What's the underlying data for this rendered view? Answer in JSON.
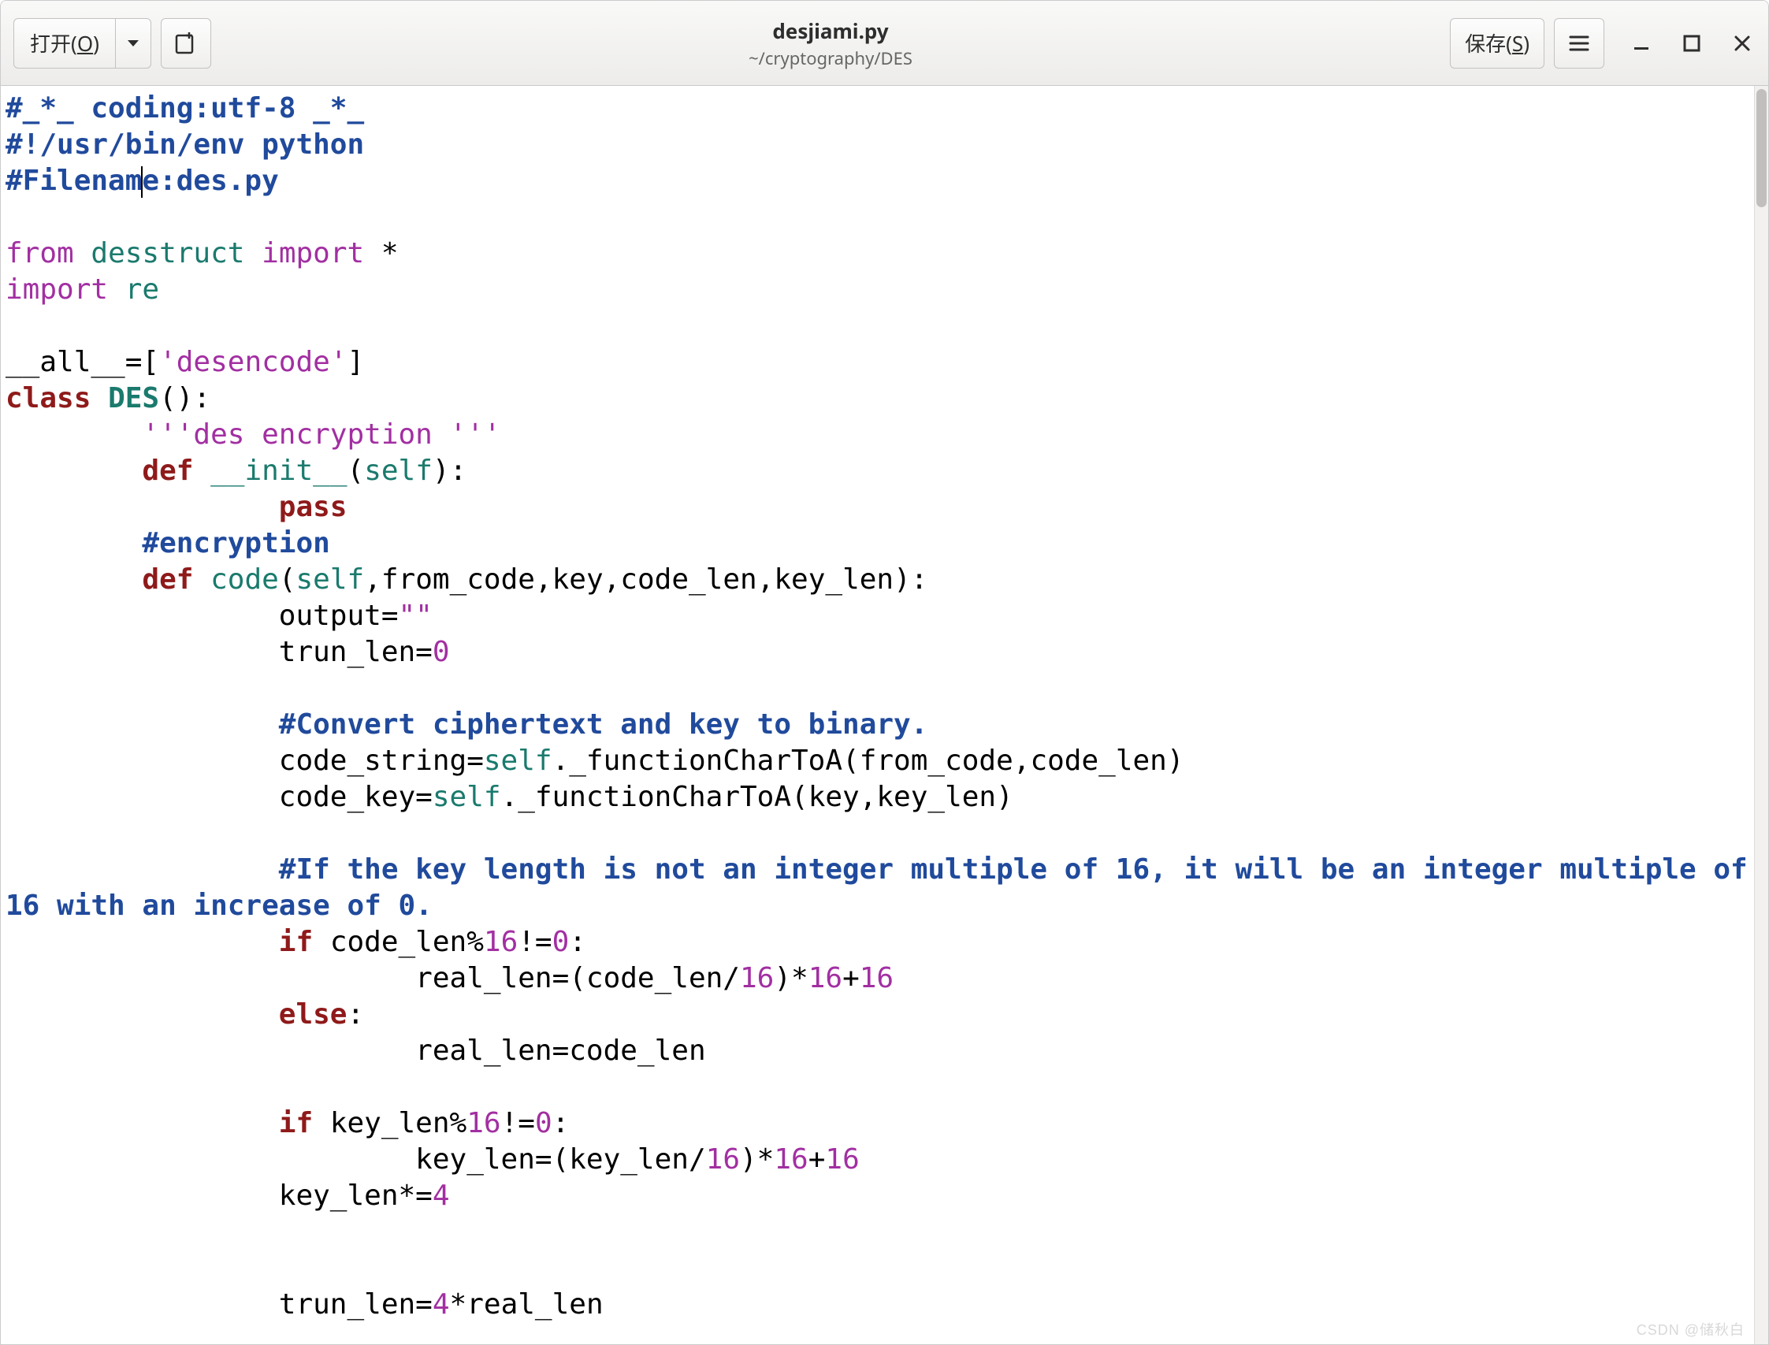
{
  "header": {
    "open_label": "打开",
    "open_mnemonic": "O",
    "save_label": "保存",
    "save_mnemonic": "S",
    "title": "desjiami.py",
    "subtitle": "~/cryptography/DES"
  },
  "icons": {
    "new_tab": "new-tab-icon",
    "hamburger": "hamburger-icon",
    "chevron_down": "chevron-down-icon",
    "minimize": "minimize-icon",
    "maximize": "maximize-icon",
    "close": "close-icon"
  },
  "watermark": "CSDN @储秋白",
  "code": {
    "lines": [
      {
        "t": "comment",
        "text": "#_*_ coding:utf-8 _*_"
      },
      {
        "t": "comment",
        "text": "#!/usr/bin/env python"
      },
      {
        "t": "comment_cursor",
        "before": "#Filenam",
        "after": "e:des.py"
      },
      {
        "t": "blank",
        "text": ""
      },
      {
        "t": "import_from",
        "from": "from",
        "mod": "desstruct",
        "imp": "import",
        "rest": " *"
      },
      {
        "t": "import_simple",
        "imp": "import",
        "mod": "re"
      },
      {
        "t": "blank",
        "text": ""
      },
      {
        "t": "assign_all",
        "name": "__all__",
        "eq": "=",
        "lb": "[",
        "str": "'desencode'",
        "rb": "]"
      },
      {
        "t": "class_line",
        "kw": "class",
        "name": "DES",
        "rest": "():"
      },
      {
        "t": "docstring",
        "indent": "        ",
        "text": "'''des encryption '''"
      },
      {
        "t": "def_line",
        "indent": "        ",
        "kw": "def",
        "name": "__init__",
        "open": "(",
        "self": "self",
        "rest": "):"
      },
      {
        "t": "pass_line",
        "indent": "                ",
        "kw": "pass"
      },
      {
        "t": "comment_ind",
        "indent": "        ",
        "text": "#encryption"
      },
      {
        "t": "def_line2",
        "indent": "        ",
        "kw": "def",
        "name": "code",
        "open": "(",
        "self": "self",
        "rest": ",from_code,key,code_len,key_len):"
      },
      {
        "t": "assign_str",
        "indent": "                ",
        "lhs": "output=",
        "str": "\"\""
      },
      {
        "t": "assign_num",
        "indent": "                ",
        "lhs": "trun_len=",
        "num": "0"
      },
      {
        "t": "blank",
        "text": ""
      },
      {
        "t": "comment_ind",
        "indent": "                ",
        "text": "#Convert ciphertext and key to binary."
      },
      {
        "t": "self_call",
        "indent": "                ",
        "lhs": "code_string=",
        "self": "self",
        "rest": "._functionCharToA(from_code,code_len)"
      },
      {
        "t": "self_call",
        "indent": "                ",
        "lhs": "code_key=",
        "self": "self",
        "rest": "._functionCharToA(key,key_len)"
      },
      {
        "t": "blank",
        "text": ""
      },
      {
        "t": "comment_wrap",
        "indent": "                ",
        "l1": "#If the key length is not an integer multiple of 16, it will be an integer multiple of ",
        "l2": "16 with an increase of 0."
      },
      {
        "t": "if_mod",
        "indent": "                ",
        "kw": "if",
        "var": " code_len%",
        "num": "16",
        "rest": "!=",
        "num2": "0",
        "colon": ":"
      },
      {
        "t": "calc",
        "indent": "                        ",
        "lhs": "real_len=(code_len/",
        "n1": "16",
        "mid": ")*",
        "n2": "16",
        "plus": "+",
        "n3": "16"
      },
      {
        "t": "else_line",
        "indent": "                ",
        "kw": "else",
        "colon": ":"
      },
      {
        "t": "plain",
        "indent": "                        ",
        "text": "real_len=code_len"
      },
      {
        "t": "blank",
        "text": ""
      },
      {
        "t": "if_mod",
        "indent": "                ",
        "kw": "if",
        "var": " key_len%",
        "num": "16",
        "rest": "!=",
        "num2": "0",
        "colon": ":"
      },
      {
        "t": "calc",
        "indent": "                        ",
        "lhs": "key_len=(key_len/",
        "n1": "16",
        "mid": ")*",
        "n2": "16",
        "plus": "+",
        "n3": "16"
      },
      {
        "t": "mul_num",
        "indent": "                ",
        "lhs": "key_len*=",
        "num": "4"
      },
      {
        "t": "blank",
        "text": ""
      },
      {
        "t": "blank",
        "text": ""
      },
      {
        "t": "mul_plain",
        "indent": "                ",
        "lhs": "trun_len=",
        "num": "4",
        "rest": "*real_len"
      }
    ]
  }
}
